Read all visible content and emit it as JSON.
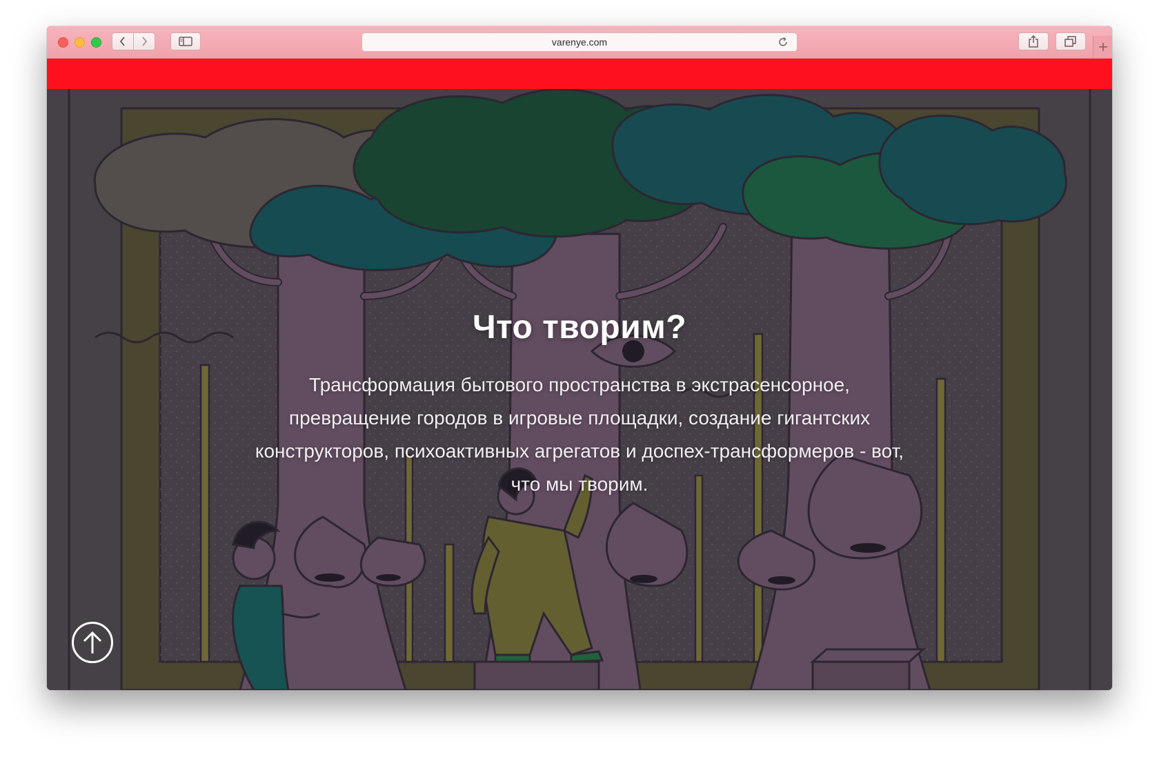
{
  "browser": {
    "url": "varenye.com"
  },
  "section": {
    "heading": "Что творим?",
    "text": "Трансформация бытового пространства в экстрасенсорное, превращение городов в игровые площадки, создание гигантских конструкторов, психоактивных агрегатов и доспех-трансформеров - вот, что мы творим."
  },
  "icons": {
    "back": "chevron-left-icon",
    "forward": "chevron-right-icon",
    "sidebar": "sidebar-icon",
    "reload": "reload-icon",
    "share": "share-icon",
    "tabs": "tabs-icon",
    "new_tab": "plus-icon",
    "scroll_up": "arrow-up-icon"
  },
  "colors": {
    "accent_bar": "#ff101f",
    "titlebar": "#f0a2ab",
    "background": "#474548"
  }
}
